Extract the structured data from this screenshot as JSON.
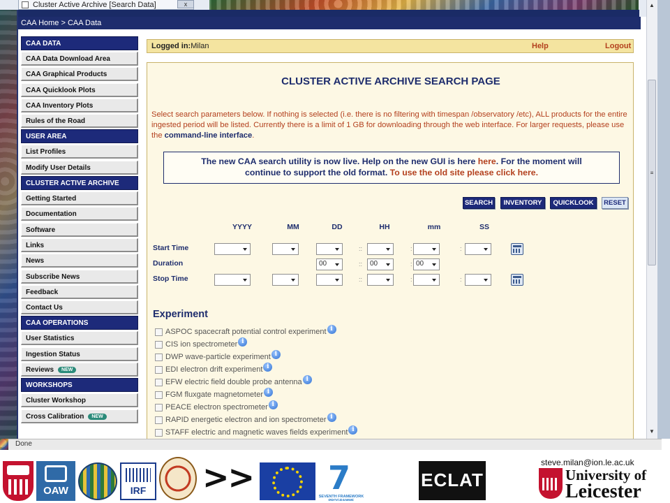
{
  "browser": {
    "tab_title": "Cluster Active Archive [Search Data]",
    "close_symbol": "x",
    "status_text": "Done"
  },
  "breadcrumb": {
    "home": "CAA Home",
    "sep": " > ",
    "current": "CAA Data"
  },
  "nav": {
    "sections": [
      {
        "title": "CAA DATA",
        "items": [
          {
            "label": "CAA Data Download Area",
            "badge": ""
          },
          {
            "label": "CAA Graphical Products",
            "badge": ""
          },
          {
            "label": "CAA Quicklook Plots",
            "badge": ""
          },
          {
            "label": "CAA Inventory Plots",
            "badge": ""
          },
          {
            "label": "Rules of the Road",
            "badge": ""
          }
        ]
      },
      {
        "title": "USER AREA",
        "items": [
          {
            "label": "List Profiles",
            "badge": ""
          },
          {
            "label": "Modify User Details",
            "badge": ""
          }
        ]
      },
      {
        "title": "CLUSTER ACTIVE ARCHIVE",
        "items": [
          {
            "label": "Getting Started",
            "badge": ""
          },
          {
            "label": "Documentation",
            "badge": ""
          },
          {
            "label": "Software",
            "badge": ""
          },
          {
            "label": "Links",
            "badge": ""
          },
          {
            "label": "News",
            "badge": ""
          },
          {
            "label": "Subscribe News",
            "badge": ""
          },
          {
            "label": "Feedback",
            "badge": ""
          },
          {
            "label": "Contact Us",
            "badge": ""
          }
        ]
      },
      {
        "title": "CAA OPERATIONS",
        "items": [
          {
            "label": "User Statistics",
            "badge": ""
          },
          {
            "label": "Ingestion Status",
            "badge": ""
          },
          {
            "label": "Reviews",
            "badge": "NEW"
          }
        ]
      },
      {
        "title": "WORKSHOPS",
        "items": [
          {
            "label": "Cluster Workshop",
            "badge": ""
          },
          {
            "label": "Cross Calibration",
            "badge": "NEW"
          }
        ]
      }
    ]
  },
  "login": {
    "label": "Logged in:",
    "user": "Milan",
    "help": "Help",
    "logout": "Logout"
  },
  "main": {
    "title": "CLUSTER ACTIVE ARCHIVE SEARCH PAGE",
    "intro": "Select search parameters below. If nothing is selected (i.e. there is no filtering with timespan /observatory /etc), ALL products for the entire ingested period will be listed. Currently there is a limit of 1 GB for downloading through the web interface. For larger requests, please use the",
    "intro_link": "command-line interface",
    "intro_end": ".",
    "notice": {
      "part1": "The new CAA search utility is now live. Help on the new GUI is here",
      "here_link": "here",
      "part2": ". For the moment will",
      "part3": "continue to support the old format.",
      "old_site_link": "To use the old site please click here."
    },
    "buttons": {
      "search": "SEARCH",
      "inventory": "INVENTORY",
      "quicklook": "QUICKLOOK",
      "reset": "RESET"
    },
    "time": {
      "headers": [
        "YYYY",
        "MM",
        "DD",
        "HH",
        "mm",
        "SS"
      ],
      "start_label": "Start Time",
      "duration_label": "Duration",
      "stop_label": "Stop Time",
      "duration_values": [
        "00",
        "00",
        "00"
      ],
      "sep_colon": ":",
      "sep_double": "::"
    },
    "experiment": {
      "title": "Experiment",
      "info_symbol": "i",
      "items": [
        "ASPOC spacecraft potential control experiment",
        "CIS ion spectrometer",
        "DWP wave-particle experiment",
        "EDI electron drift experiment",
        "EFW electric field double probe antenna",
        "FGM fluxgate magnetometer",
        "PEACE electron spectrometer",
        "RAPID energetic electron and ion spectrometer",
        "STAFF electric and magnetic waves fields experiment"
      ]
    }
  },
  "footer": {
    "email": "steve.milan@ion.le.ac.uk",
    "arrows": ">>",
    "oaw": "OAW",
    "irf": "IRF",
    "fp7_seven": "7",
    "fp7_caption": "SEVENTH FRAMEWORK PROGRAMME",
    "eclat": "ECLAT",
    "leicester_line1": "University of",
    "leicester_line2": "Leicester"
  }
}
